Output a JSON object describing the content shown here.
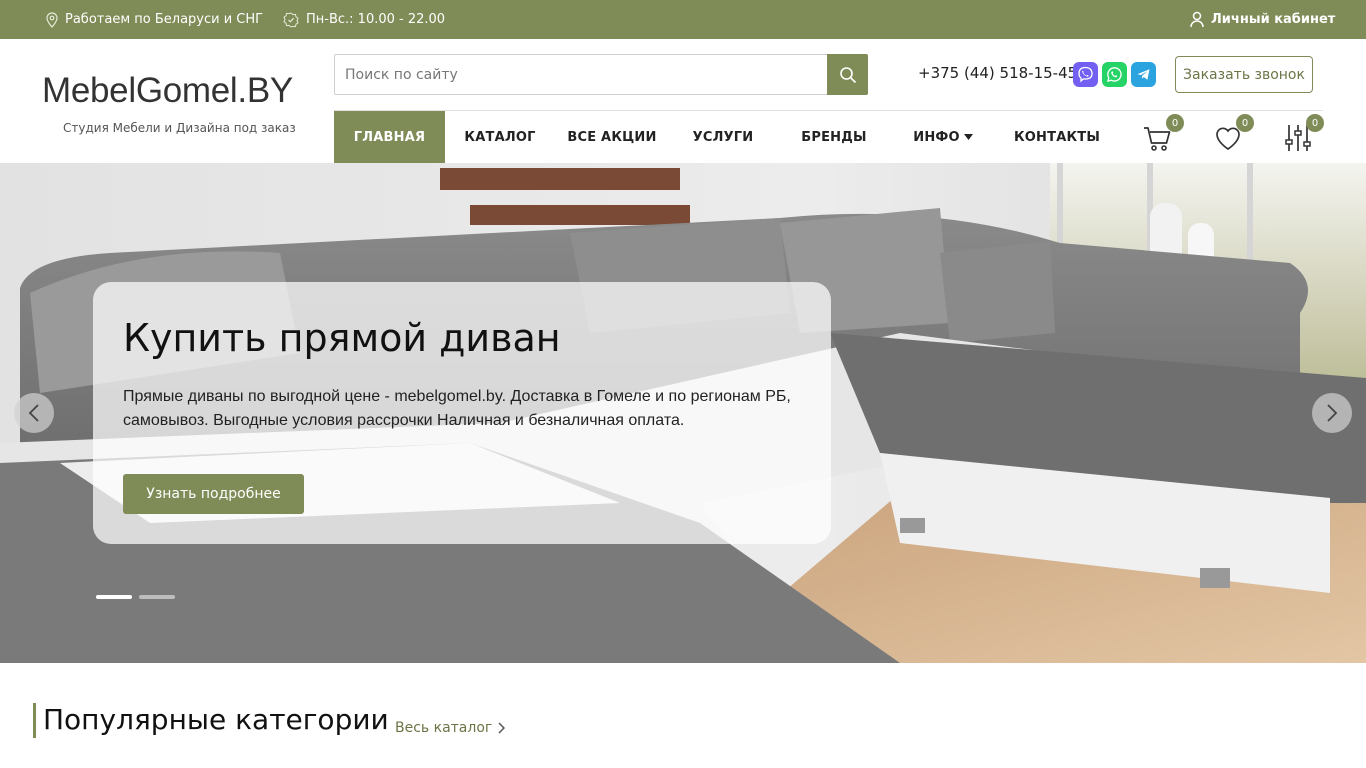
{
  "topbar": {
    "region": "Работаем по Беларуси и СНГ",
    "hours": "Пн-Вс.: 10.00 - 22.00",
    "account": "Личный кабинет"
  },
  "header": {
    "logo": "MebelGomel.BY",
    "tagline": "Студия Мебели и Дизайна под заказ",
    "search_placeholder": "Поиск по сайту",
    "phone": "+375 (44) 518-15-45",
    "callback": "Заказать звонок",
    "cart_count": "0",
    "favorites_count": "0",
    "compare_count": "0"
  },
  "nav": {
    "items": [
      {
        "label": "ГЛАВНАЯ"
      },
      {
        "label": "КАТАЛОГ"
      },
      {
        "label": "ВСЕ АКЦИИ"
      },
      {
        "label": "УСЛУГИ"
      },
      {
        "label": "БРЕНДЫ"
      },
      {
        "label": "ИНФО"
      },
      {
        "label": "КОНТАКТЫ"
      }
    ]
  },
  "hero": {
    "title": "Купить прямой диван",
    "text": "Прямые диваны по выгодной цене - mebelgomel.by. Доставка в Гомеле и по регионам РБ, самовывоз. Выгодные условия рассрочки Наличная и безналичная оплата.",
    "button": "Узнать подробнее"
  },
  "section": {
    "title": "Популярные категории",
    "link": "Весь каталог"
  },
  "colors": {
    "accent": "#7f8c57"
  }
}
